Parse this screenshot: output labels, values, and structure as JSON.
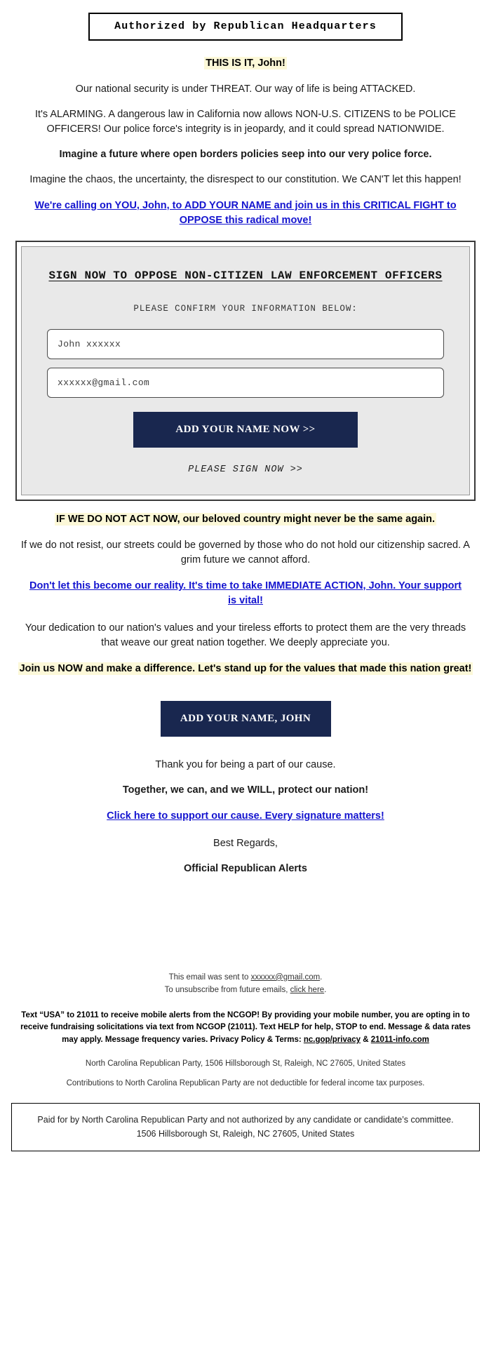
{
  "banner": {
    "text": "Authorized by Republican Headquarters"
  },
  "message": {
    "headline": "THIS IS IT, John!",
    "para1": "Our national security is under THREAT. Our way of life is being ATTACKED.",
    "para2": "It's ALARMING. A dangerous law in California now allows NON-U.S. CITIZENS to be POLICE OFFICERS! Our police force's integrity is in jeopardy, and it could spread NATIONWIDE.",
    "para3_bold": "Imagine a future where open borders policies seep into our very police force.",
    "para4": "Imagine the chaos, the uncertainty, the disrespect to our constitution. We CAN'T let this happen!",
    "call_to_action_link": "We're calling on YOU, John, to ADD YOUR NAME and join us in this CRITICAL FIGHT to OPPOSE this radical move!"
  },
  "form": {
    "title": "SIGN NOW TO OPPOSE NON-CITIZEN LAW ENFORCEMENT OFFICERS",
    "subtitle": "PLEASE CONFIRM YOUR INFORMATION BELOW:",
    "name_value": "John xxxxxx",
    "name_placeholder": "John xxxxxx",
    "email_value": "xxxxxx@gmail.com",
    "email_placeholder": "xxxxxx@gmail.com",
    "submit_label": "ADD YOUR NAME NOW >>",
    "please_sign": "PLEASE SIGN NOW >>"
  },
  "after_form": {
    "urgent_highlight": "IF WE DO NOT ACT NOW, our beloved country might never be the same again.",
    "para5": "If we do not resist, our streets could be governed by those who do not hold our citizenship sacred. A grim future we cannot afford.",
    "link2": "Don't let this become our reality. It's time to take IMMEDIATE ACTION, John. Your support is vital!",
    "para6": "Your dedication to our nation's values and your tireless efforts to protect them are the very threads that weave our great nation together. We deeply appreciate you.",
    "join_highlight": "Join us NOW and make a difference. Let's stand up for the values that made this nation great!",
    "cta2_label": "ADD YOUR NAME, JOHN",
    "thanks": "Thank you for being a part of our cause.",
    "together_bold": "Together, we can, and we WILL, protect our nation!",
    "link3": "Click here to support our cause. Every signature matters!",
    "best_regards": "Best Regards,",
    "signature": "Official Republican Alerts"
  },
  "footer": {
    "sent_prefix": "This email was sent to ",
    "sent_email": "xxxxxx@gmail.com",
    "sent_suffix": ".",
    "unsub_prefix": "To unsubscribe from future emails, ",
    "unsub_link": "click here",
    "unsub_suffix": ".",
    "legal_part1": "Text “USA” to 21011 to receive mobile alerts from the NCGOP! By providing your mobile number, you are opting in to receive fundraising solicitations via text from NCGOP (21011). Text HELP for help, STOP to end. Message & data rates may apply. Message frequency varies. Privacy Policy & Terms: ",
    "legal_link1": "nc.gop/privacy",
    "legal_amp": " & ",
    "legal_link2": "21011-info.com",
    "address": "North Carolina Republican Party, 1506 Hillsborough St, Raleigh, NC 27605, United States",
    "contributions": "Contributions to North Carolina Republican Party are not deductible for federal income tax purposes.",
    "paid_for": "Paid for by North Carolina Republican Party and not authorized by any candidate or candidate’s committee. 1506 Hillsborough St, Raleigh, NC 27605, United States"
  },
  "colors": {
    "link_blue": "#1414cf",
    "navy_button": "#19274f",
    "highlight_yellow": "#fcf8d8",
    "panel_gray": "#e9e9e9"
  }
}
